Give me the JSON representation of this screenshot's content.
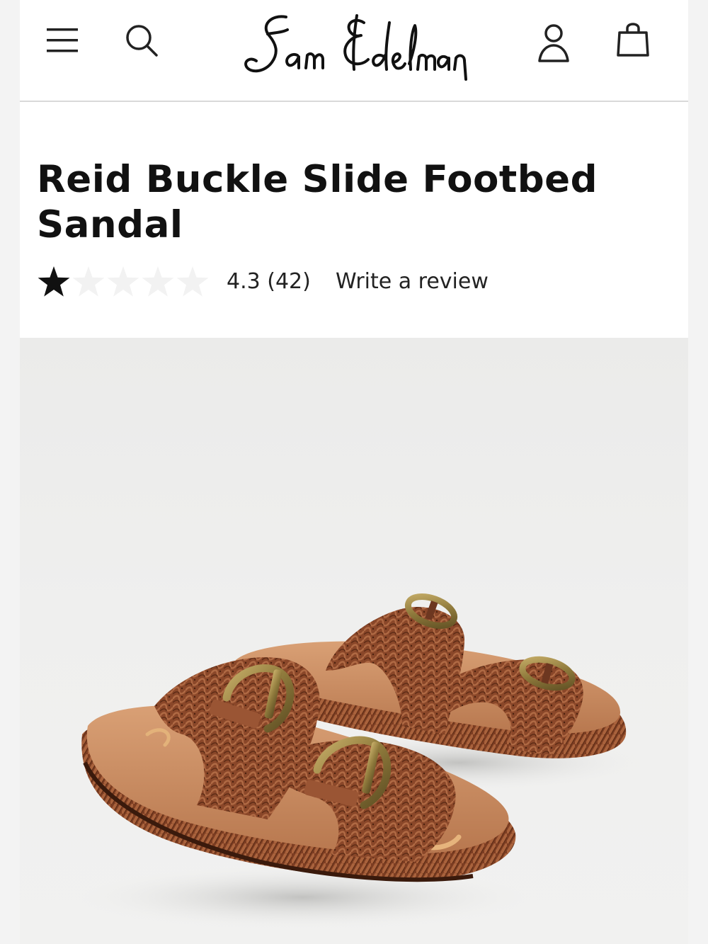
{
  "brand": {
    "logo_text": "Sam Edelman"
  },
  "header": {
    "icons": [
      "hamburger-menu-icon",
      "search-icon",
      "account-icon",
      "shopping-bag-icon"
    ]
  },
  "product": {
    "title": "Reid Buckle Slide Footbed Sandal",
    "rating_value": 4.3,
    "rating_max": 5,
    "rating_text": "4.3 (42)",
    "write_review_label": "Write a review"
  },
  "colors": {
    "text": "#111111",
    "divider": "#d9d9d9",
    "image_background": "#efefee",
    "sandal_brown": "#8c4a2c",
    "footbed_tan": "#c98d60",
    "buckle_brass": "#a08a4a"
  }
}
